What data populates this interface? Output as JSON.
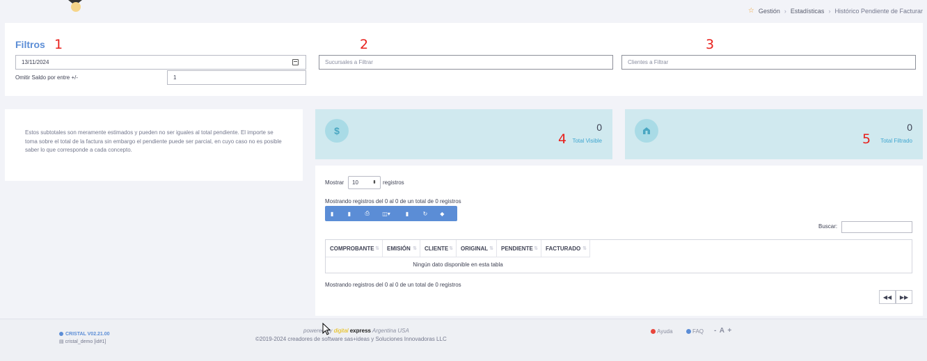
{
  "breadcrumb": {
    "items": [
      "Gestión",
      "Estadísticas",
      "Histórico Pendiente de Facturar"
    ]
  },
  "filters": {
    "title": "Filtros",
    "date_value": "13/11/2024",
    "omit_label": "Omitir Saldo por entre +/-",
    "omit_value": "1",
    "branches_placeholder": "Sucursales a Filtrar",
    "clients_placeholder": "Clientes a Filtrar"
  },
  "annotations": [
    "1",
    "2",
    "3",
    "4",
    "5"
  ],
  "info_text": "Estos subtotales son meramente estimados y pueden no ser iguales al total pendiente. El importe se toma sobre el total de la factura sin embargo el pendiente puede ser parcial, en cuyo caso no es posible saber lo que corresponde a cada concepto.",
  "stats": [
    {
      "value": "0",
      "label": "Total Visible",
      "icon": "dollar-icon"
    },
    {
      "value": "0",
      "label": "Total Filtrado",
      "icon": "bank-icon"
    }
  ],
  "table": {
    "show_label": "Mostrar",
    "page_size": "10",
    "records_label": "registros",
    "info_top": "Mostrando registros del 0 al 0 de un total de 0 registros",
    "info_bottom": "Mostrando registros del 0 al 0 de un total de 0 registros",
    "search_label": "Buscar:",
    "columns": [
      "COMPROBANTE",
      "EMISIÓN",
      "CLIENTE",
      "ORIGINAL",
      "PENDIENTE",
      "FACTURADO"
    ],
    "empty": "Ningún dato disponible en esta tabla",
    "toolbar_icons": [
      "excel-icon",
      "pdf-icon",
      "print-icon",
      "columns-icon",
      "csv-icon",
      "refresh-icon",
      "eraser-icon"
    ]
  },
  "footer": {
    "version": "CRISTAL V02.21.00",
    "user": "cristal_demo [id#1]",
    "powered_by": "powered by",
    "brand_a": "digital",
    "brand_b": "express",
    "brand_c": "Argentina USA",
    "copyright": "©2019-2024 creadores de software sas+ideas y Soluciones Innovadoras LLC",
    "help": "Ayuda",
    "faq": "FAQ",
    "zoom": "- A +"
  },
  "colors": {
    "accent": "#5b8dd6",
    "stat_bg": "#d0e9ef",
    "annotation": "#e8201c"
  }
}
